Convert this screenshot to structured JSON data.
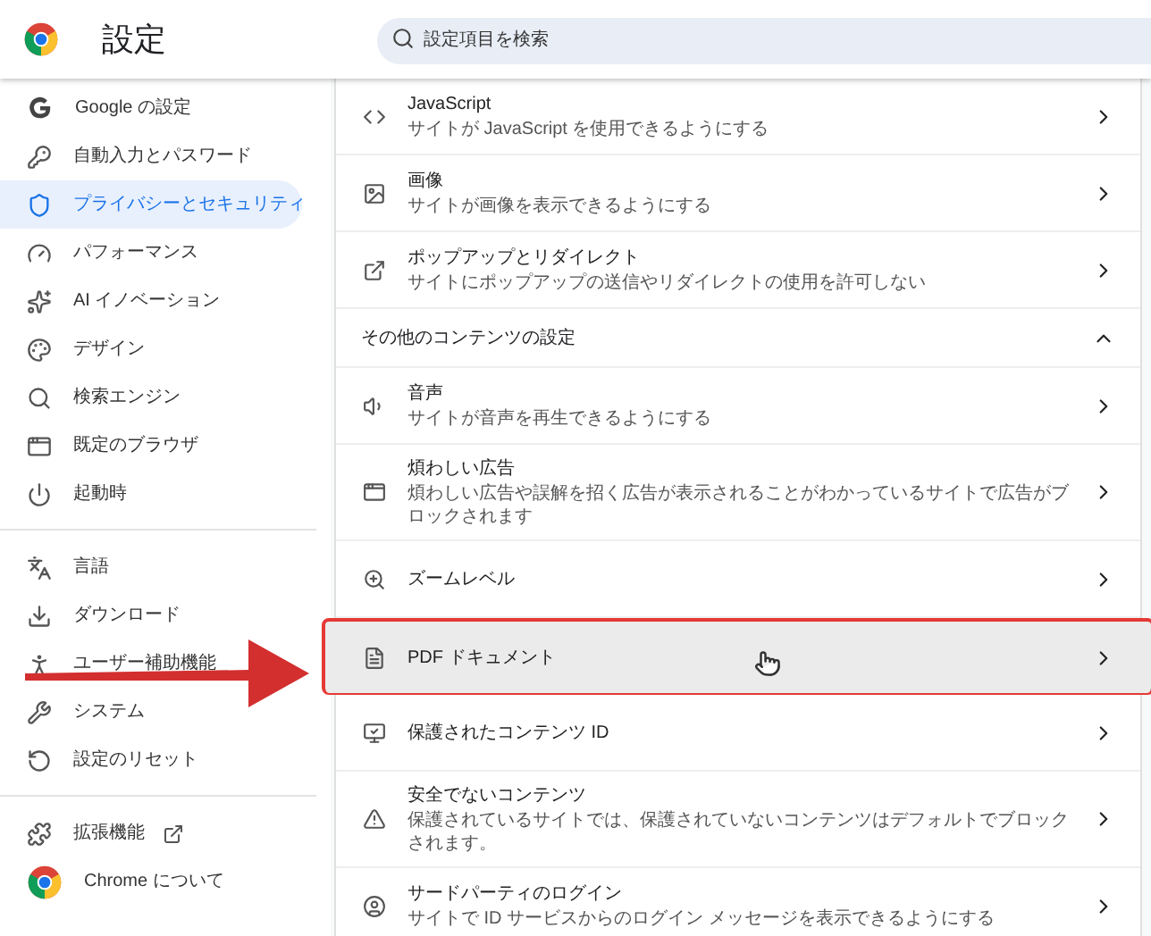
{
  "header": {
    "title": "設定",
    "search": {
      "placeholder": "設定項目を検索"
    }
  },
  "sidebar": {
    "groups": [
      [
        {
          "label": "Google の設定",
          "selected": false
        },
        {
          "label": "自動入力とパスワード",
          "selected": false
        },
        {
          "label": "プライバシーとセキュリティ",
          "selected": true
        },
        {
          "label": "パフォーマンス",
          "selected": false
        },
        {
          "label": "AI イノベーション",
          "selected": false
        },
        {
          "label": "デザイン",
          "selected": false
        },
        {
          "label": "検索エンジン",
          "selected": false
        },
        {
          "label": "既定のブラウザ",
          "selected": false
        },
        {
          "label": "起動時",
          "selected": false
        }
      ],
      [
        {
          "label": "言語",
          "selected": false
        },
        {
          "label": "ダウンロード",
          "selected": false
        },
        {
          "label": "ユーザー補助機能",
          "selected": false
        },
        {
          "label": "システム",
          "selected": false
        },
        {
          "label": "設定のリセット",
          "selected": false
        }
      ],
      [
        {
          "label": "拡張機能",
          "selected": false,
          "external": true
        },
        {
          "label": "Chrome について",
          "selected": false
        }
      ]
    ]
  },
  "rows": [
    {
      "kind": "setting",
      "title": "JavaScript",
      "subtitle": "サイトが JavaScript を使用できるようにする",
      "highlighted": false
    },
    {
      "kind": "setting",
      "title": "画像",
      "subtitle": "サイトが画像を表示できるようにする",
      "highlighted": false
    },
    {
      "kind": "setting",
      "title": "ポップアップとリダイレクト",
      "subtitle": "サイトにポップアップの送信やリダイレクトの使用を許可しない",
      "highlighted": false
    },
    {
      "kind": "section",
      "title": "その他のコンテンツの設定",
      "expanded": true
    },
    {
      "kind": "setting",
      "title": "音声",
      "subtitle": "サイトが音声を再生できるようにする",
      "highlighted": false
    },
    {
      "kind": "setting",
      "title": "煩わしい広告",
      "subtitle": "煩わしい広告や誤解を招く広告が表示されることがわかっているサイトで広告がブロックされます",
      "highlighted": false
    },
    {
      "kind": "setting",
      "title": "ズームレベル",
      "highlighted": false
    },
    {
      "kind": "setting",
      "title": "PDF ドキュメント",
      "highlighted": true
    },
    {
      "kind": "setting",
      "title": "保護されたコンテンツ ID",
      "highlighted": false
    },
    {
      "kind": "setting",
      "title": "安全でないコンテンツ",
      "subtitle": "保護されているサイトでは、保護されていないコンテンツはデフォルトでブロックされます。",
      "highlighted": false
    },
    {
      "kind": "setting",
      "title": "サードパーティのログイン",
      "subtitle": "サイトで ID サービスからのログイン メッセージを表示できるようにする",
      "highlighted": false
    }
  ]
}
